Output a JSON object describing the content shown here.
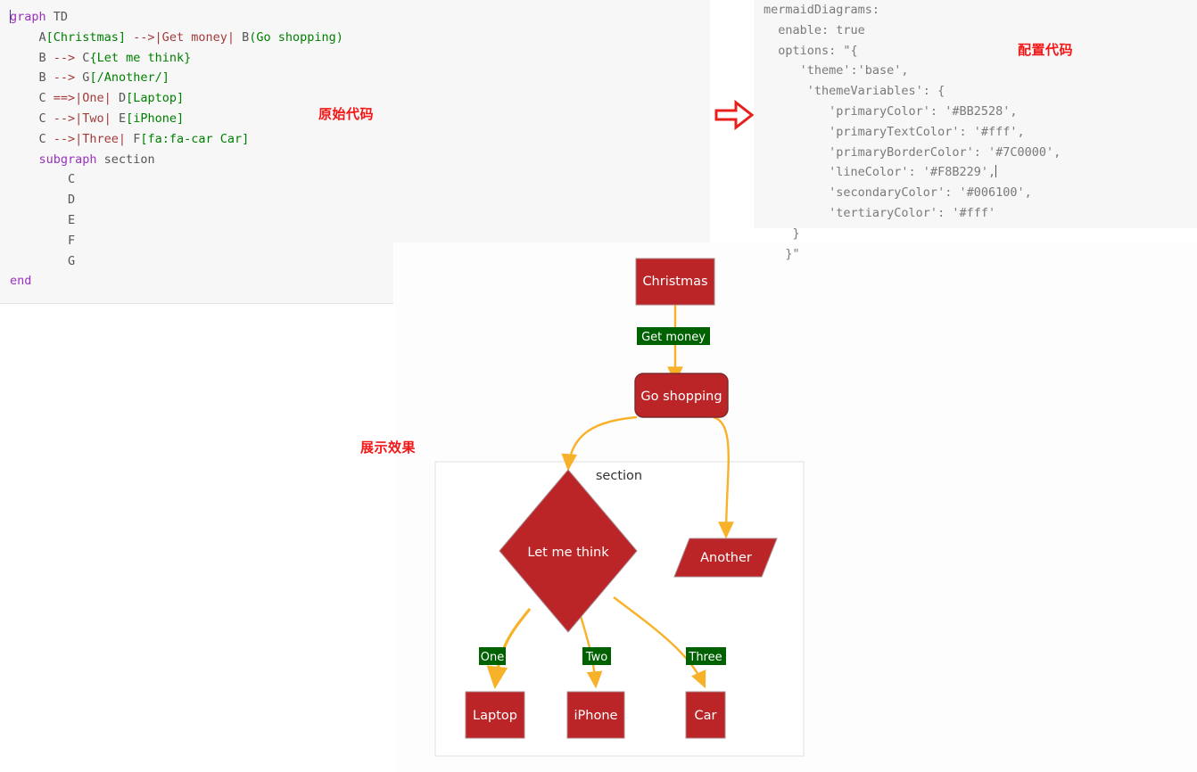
{
  "source_code": {
    "title_annotation": "原始代码",
    "lines": [
      [
        {
          "t": "caret",
          "v": ""
        },
        {
          "t": "kw",
          "v": "graph"
        },
        {
          "t": "plain",
          "v": " TD"
        }
      ],
      [
        {
          "t": "plain",
          "v": "    A"
        },
        {
          "t": "bracket",
          "v": "[Christmas]"
        },
        {
          "t": "arrow",
          "v": " -->|Get money|"
        },
        {
          "t": "plain",
          "v": " B"
        },
        {
          "t": "bracket",
          "v": "(Go shopping)"
        }
      ],
      [
        {
          "t": "plain",
          "v": "    B "
        },
        {
          "t": "arrow",
          "v": "-->"
        },
        {
          "t": "plain",
          "v": " C"
        },
        {
          "t": "bracket",
          "v": "{Let me think}"
        }
      ],
      [
        {
          "t": "plain",
          "v": "    B "
        },
        {
          "t": "arrow",
          "v": "-->"
        },
        {
          "t": "plain",
          "v": " G"
        },
        {
          "t": "bracket",
          "v": "[/Another/]"
        }
      ],
      [
        {
          "t": "plain",
          "v": "    C "
        },
        {
          "t": "arrow",
          "v": "==>|One|"
        },
        {
          "t": "plain",
          "v": " D"
        },
        {
          "t": "bracket",
          "v": "[Laptop]"
        }
      ],
      [
        {
          "t": "plain",
          "v": "    C "
        },
        {
          "t": "arrow",
          "v": "-->|Two|"
        },
        {
          "t": "plain",
          "v": " E"
        },
        {
          "t": "bracket",
          "v": "[iPhone]"
        }
      ],
      [
        {
          "t": "plain",
          "v": "    C "
        },
        {
          "t": "arrow",
          "v": "-->|Three|"
        },
        {
          "t": "plain",
          "v": " F"
        },
        {
          "t": "bracket",
          "v": "[fa:fa-car Car]"
        }
      ],
      [
        {
          "t": "plain",
          "v": "    "
        },
        {
          "t": "kw",
          "v": "subgraph"
        },
        {
          "t": "plain",
          "v": " section"
        }
      ],
      [
        {
          "t": "plain",
          "v": "        C"
        }
      ],
      [
        {
          "t": "plain",
          "v": "        D"
        }
      ],
      [
        {
          "t": "plain",
          "v": "        E"
        }
      ],
      [
        {
          "t": "plain",
          "v": "        F"
        }
      ],
      [
        {
          "t": "plain",
          "v": "        G"
        }
      ],
      [
        {
          "t": "kw",
          "v": "end"
        }
      ]
    ]
  },
  "config_code": {
    "title_annotation": "配置代码",
    "lines": [
      [
        {
          "t": "gray",
          "v": "mermaidDiagrams:"
        }
      ],
      [
        {
          "t": "gray",
          "v": "  enable: true"
        }
      ],
      [
        {
          "t": "gray",
          "v": "  options: \"{"
        }
      ],
      [
        {
          "t": "gray",
          "v": "     'theme':'base',"
        }
      ],
      [
        {
          "t": "gray",
          "v": "      'themeVariables': {"
        }
      ],
      [
        {
          "t": "gray",
          "v": "         'primaryColor': '#BB2528',"
        }
      ],
      [
        {
          "t": "gray",
          "v": "         'primaryTextColor': '#fff',"
        }
      ],
      [
        {
          "t": "gray",
          "v": "         'primaryBorderColor': '#7C0000',"
        }
      ],
      [
        {
          "t": "gray",
          "v": "         'lineColor': '#F8B229',"
        },
        {
          "t": "caret-inline",
          "v": ""
        }
      ],
      [
        {
          "t": "gray",
          "v": "         'secondaryColor': '#006100',"
        }
      ],
      [
        {
          "t": "gray",
          "v": "         'tertiaryColor': '#fff'"
        }
      ],
      [
        {
          "t": "gray",
          "v": "    }"
        }
      ],
      [
        {
          "t": "gray",
          "v": "   }\""
        }
      ]
    ]
  },
  "diagram": {
    "title_annotation": "展示效果",
    "cluster_label": "section",
    "nodes": [
      {
        "id": "A",
        "label": "Christmas",
        "shape": "rect"
      },
      {
        "id": "B",
        "label": "Go shopping",
        "shape": "round"
      },
      {
        "id": "C",
        "label": "Let me think",
        "shape": "diamond"
      },
      {
        "id": "G",
        "label": "Another",
        "shape": "parallelogram"
      },
      {
        "id": "D",
        "label": "Laptop",
        "shape": "rect"
      },
      {
        "id": "E",
        "label": "iPhone",
        "shape": "rect"
      },
      {
        "id": "F",
        "label": "Car",
        "shape": "rect"
      }
    ],
    "edges": [
      {
        "from": "A",
        "to": "B",
        "label": "Get money"
      },
      {
        "from": "B",
        "to": "C",
        "label": ""
      },
      {
        "from": "B",
        "to": "G",
        "label": ""
      },
      {
        "from": "C",
        "to": "D",
        "label": "One"
      },
      {
        "from": "C",
        "to": "E",
        "label": "Two"
      },
      {
        "from": "C",
        "to": "F",
        "label": "Three"
      }
    ]
  },
  "theme_colors": {
    "primaryColor": "#BB2528",
    "primaryTextColor": "#fff",
    "primaryBorderColor": "#7C0000",
    "lineColor": "#F8B229",
    "secondaryColor": "#006100",
    "tertiaryColor": "#fff",
    "annotation_red": "#f31616"
  }
}
